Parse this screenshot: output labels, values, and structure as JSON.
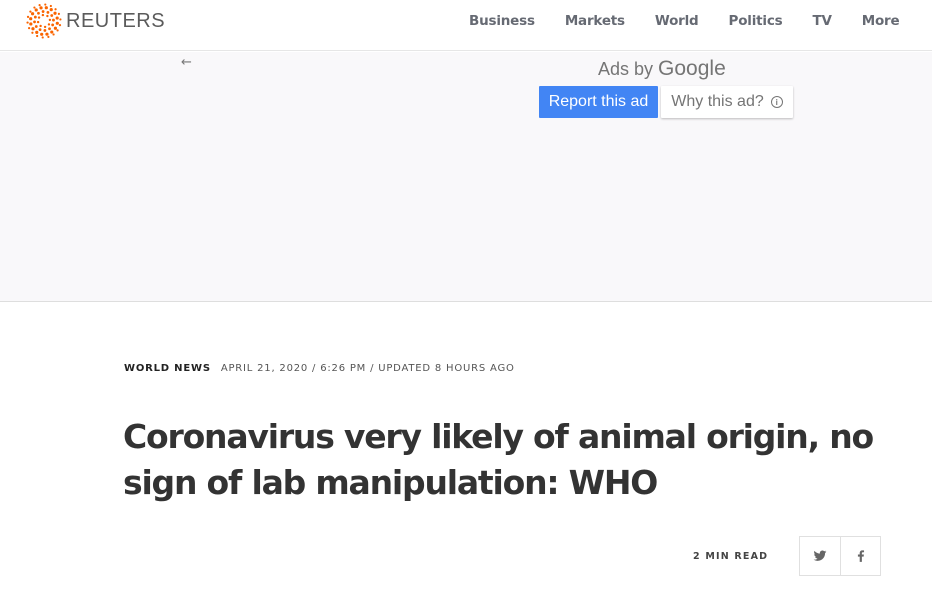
{
  "header": {
    "logo_text": "REUTERS",
    "nav": [
      "Business",
      "Markets",
      "World",
      "Politics",
      "TV",
      "More"
    ]
  },
  "ad": {
    "back_icon": "arrow-left-icon",
    "ads_by": "Ads by",
    "google": "Google",
    "report_label": "Report this ad",
    "why_label": "Why this ad?",
    "info_icon": "info-icon",
    "colors": {
      "report_bg": "#4285f4"
    }
  },
  "article": {
    "section": "WORLD NEWS",
    "dateline": "APRIL 21, 2020 / 6:26 PM / UPDATED 8 HOURS AGO",
    "headline": "Coronavirus very likely of animal origin, no sign of lab manipulation: WHO",
    "read_time": "2 MIN READ",
    "share": [
      {
        "name": "twitter",
        "icon": "twitter-icon"
      },
      {
        "name": "facebook",
        "icon": "facebook-icon"
      }
    ]
  },
  "colors": {
    "brand_orange": "#fa6400"
  }
}
